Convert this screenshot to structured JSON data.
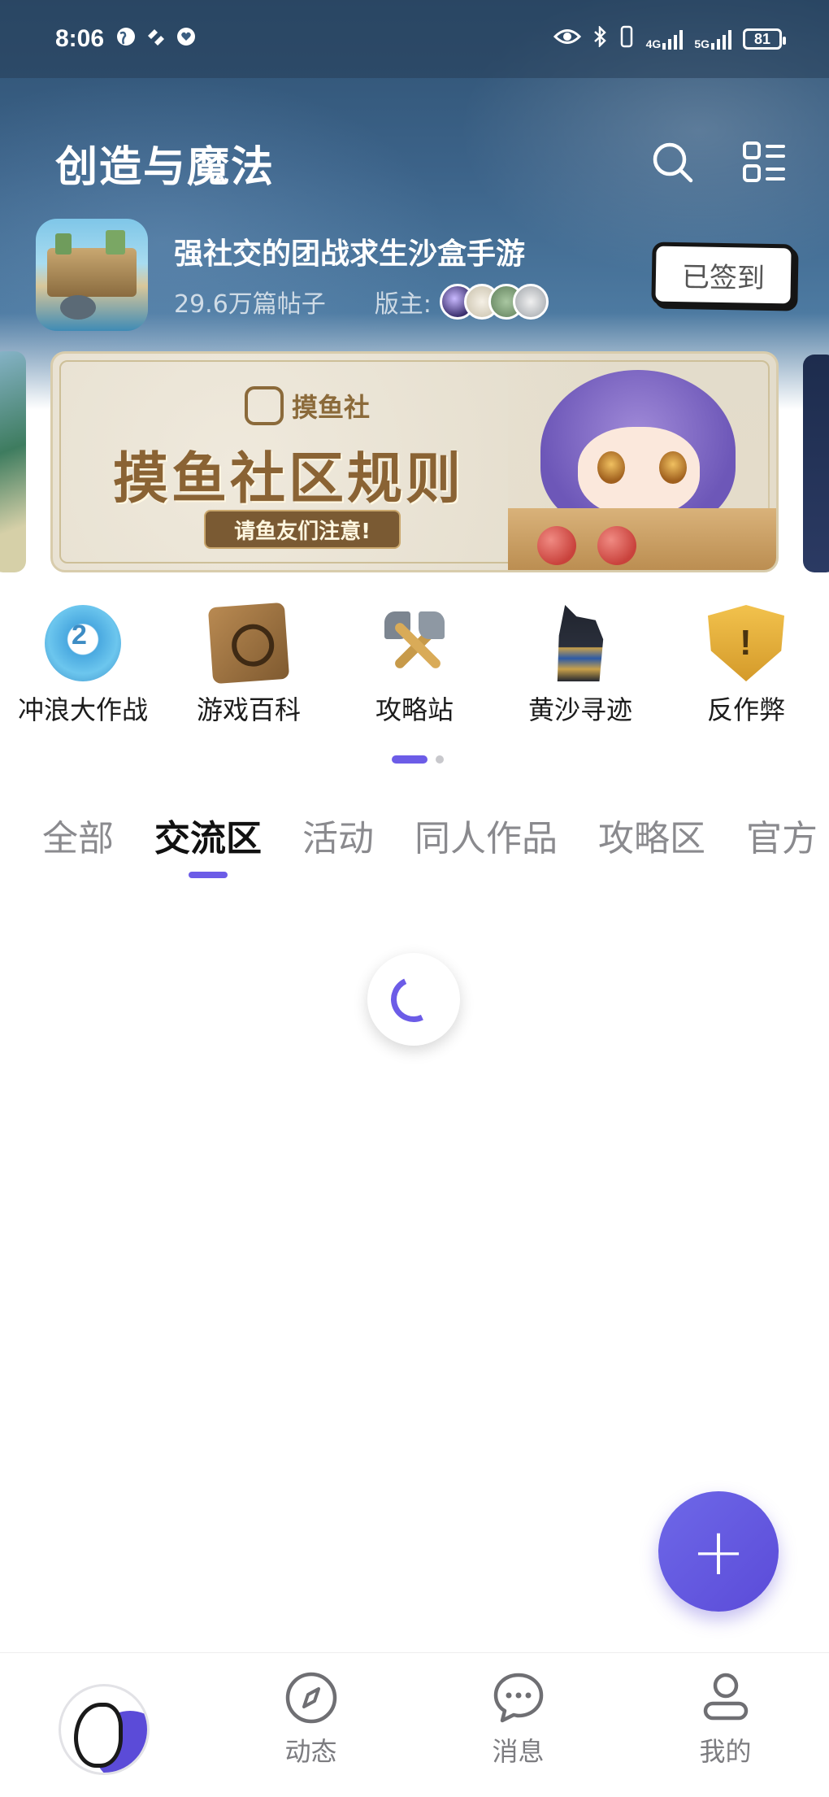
{
  "status_bar": {
    "time": "8:06",
    "network_1": "4G",
    "network_2": "5G",
    "battery": "81"
  },
  "header": {
    "title": "创造与魔法",
    "icons": [
      "search-icon",
      "grid-menu-icon"
    ]
  },
  "game": {
    "description": "强社交的团战求生沙盒手游",
    "post_count": "29.6万篇帖子",
    "moderator_label": "版主:",
    "checkin_label": "已签到"
  },
  "banner": {
    "brand": "摸鱼社",
    "headline": "摸鱼社区规则",
    "pill": "请鱼友们注意!"
  },
  "shortcuts": [
    {
      "label": "冲浪大作战",
      "icon": "anniversary-badge-icon"
    },
    {
      "label": "游戏百科",
      "icon": "book-icon"
    },
    {
      "label": "攻略站",
      "icon": "crossed-axes-icon"
    },
    {
      "label": "黄沙寻迹",
      "icon": "anubis-icon"
    },
    {
      "label": "反作弊",
      "icon": "warning-shield-icon"
    }
  ],
  "tabs": [
    "全部",
    "交流区",
    "活动",
    "同人作品",
    "攻略区",
    "官方"
  ],
  "active_tab": "交流区",
  "fab_label": "+",
  "bottom_nav": [
    {
      "label": "",
      "icon": "home-avatar"
    },
    {
      "label": "动态",
      "icon": "compass-icon"
    },
    {
      "label": "消息",
      "icon": "chat-bubble-icon"
    },
    {
      "label": "我的",
      "icon": "profile-icon"
    }
  ],
  "colors": {
    "accent": "#6c5ce7",
    "header_bg": "#3c6389"
  }
}
